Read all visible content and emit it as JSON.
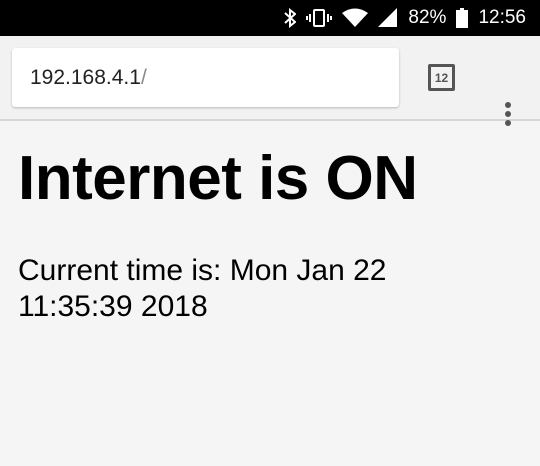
{
  "status_bar": {
    "battery": "82%",
    "time": "12:56",
    "icons": [
      "bluetooth-icon",
      "vibrate-icon",
      "wifi-icon",
      "signal-icon",
      "battery-icon"
    ]
  },
  "browser": {
    "url_host": "192.168.4.1",
    "url_path": "/",
    "tab_count": "12"
  },
  "page": {
    "heading": "Internet is ON",
    "time_line1": "Current time is: Mon Jan 22",
    "time_line2": "11:35:39 2018"
  }
}
